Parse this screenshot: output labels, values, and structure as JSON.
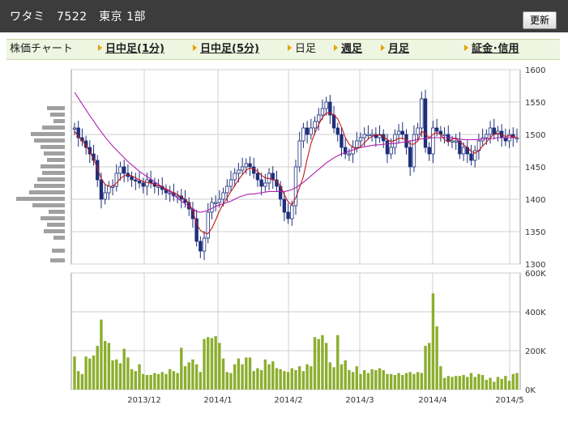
{
  "header": {
    "title": "ワタミ　7522　東京 1部",
    "refresh_label": "更新"
  },
  "tabs": [
    {
      "label": "株価チャート",
      "link": false,
      "arrow": false
    },
    {
      "label": "日中足(1分)",
      "link": true,
      "arrow": true
    },
    {
      "label": "日中足(5分)",
      "link": true,
      "arrow": true
    },
    {
      "label": "日足",
      "link": false,
      "arrow": true
    },
    {
      "label": "週足",
      "link": true,
      "arrow": true
    },
    {
      "label": "月足",
      "link": true,
      "arrow": true
    },
    {
      "label": "証金･信用",
      "link": true,
      "arrow": true
    }
  ],
  "colors": {
    "up": "#1f2f7a",
    "down": "#1f2f7a",
    "ma_short": "#c01a1a",
    "ma_long": "#b020b0",
    "volume": "#8cae2e",
    "profile": "#a0a0a0",
    "grid": "#cfcfcf"
  },
  "chart_data": [
    {
      "type": "candlestick",
      "title": "",
      "ylim": [
        1300,
        1600
      ],
      "yticks": [
        "1600",
        "1550",
        "1500",
        "1450",
        "1400",
        "1350",
        "1300"
      ],
      "x_labels": [
        "2013/12",
        "2014/1",
        "2014/2",
        "2014/3",
        "2014/4",
        "2014/5"
      ],
      "close": [
        1510,
        1495,
        1490,
        1480,
        1470,
        1460,
        1430,
        1400,
        1410,
        1420,
        1420,
        1440,
        1450,
        1440,
        1435,
        1430,
        1428,
        1425,
        1420,
        1430,
        1425,
        1420,
        1420,
        1415,
        1410,
        1410,
        1405,
        1405,
        1400,
        1395,
        1385,
        1370,
        1335,
        1320,
        1340,
        1380,
        1395,
        1395,
        1400,
        1410,
        1420,
        1430,
        1440,
        1445,
        1450,
        1455,
        1450,
        1440,
        1430,
        1420,
        1425,
        1440,
        1430,
        1420,
        1400,
        1380,
        1370,
        1390,
        1450,
        1490,
        1510,
        1500,
        1510,
        1520,
        1530,
        1540,
        1550,
        1530,
        1510,
        1500,
        1480,
        1470,
        1470,
        1480,
        1490,
        1495,
        1500,
        1500,
        1500,
        1495,
        1500,
        1490,
        1470,
        1480,
        1500,
        1505,
        1500,
        1480,
        1450,
        1500,
        1510,
        1555,
        1480,
        1470,
        1510,
        1505,
        1500,
        1500,
        1490,
        1490,
        1490,
        1470,
        1480,
        1470,
        1460,
        1475,
        1490,
        1495,
        1500,
        1510,
        1500,
        1505,
        1495,
        1490,
        1500,
        1495,
        1495
      ],
      "ma_short": [
        1505,
        1497,
        1490,
        1483,
        1473,
        1462,
        1448,
        1432,
        1423,
        1420,
        1420,
        1425,
        1432,
        1436,
        1438,
        1436,
        1433,
        1430,
        1427,
        1426,
        1425,
        1423,
        1421,
        1419,
        1416,
        1413,
        1410,
        1407,
        1404,
        1400,
        1394,
        1382,
        1362,
        1352,
        1348,
        1347,
        1355,
        1368,
        1382,
        1393,
        1402,
        1412,
        1421,
        1430,
        1438,
        1445,
        1448,
        1447,
        1443,
        1437,
        1433,
        1432,
        1431,
        1428,
        1420,
        1407,
        1396,
        1391,
        1402,
        1418,
        1435,
        1462,
        1486,
        1502,
        1515,
        1526,
        1533,
        1533,
        1530,
        1524,
        1511,
        1495,
        1485,
        1480,
        1478,
        1481,
        1487,
        1493,
        1497,
        1499,
        1499,
        1497,
        1492,
        1489,
        1491,
        1494,
        1494,
        1492,
        1485,
        1485,
        1490,
        1505,
        1501,
        1495,
        1500,
        1503,
        1500,
        1492,
        1488,
        1493,
        1494,
        1489,
        1484,
        1480,
        1474,
        1471,
        1475,
        1482,
        1488,
        1495,
        1501,
        1502,
        1499,
        1497,
        1498,
        1497,
        1495
      ],
      "ma_long": [
        1565,
        1556,
        1547,
        1538,
        1529,
        1521,
        1512,
        1504,
        1496,
        1489,
        1482,
        1476,
        1470,
        1464,
        1458,
        1453,
        1448,
        1443,
        1439,
        1435,
        1431,
        1427,
        1423,
        1419,
        1415,
        1411,
        1407,
        1402,
        1397,
        1393,
        1389,
        1385,
        1381,
        1380,
        1381,
        1383,
        1386,
        1389,
        1391,
        1393,
        1395,
        1397,
        1400,
        1403,
        1405,
        1407,
        1408,
        1408,
        1409,
        1410,
        1411,
        1412,
        1412,
        1412,
        1412,
        1412,
        1413,
        1415,
        1418,
        1422,
        1426,
        1431,
        1436,
        1441,
        1446,
        1451,
        1456,
        1460,
        1464,
        1467,
        1470,
        1472,
        1474,
        1476,
        1478,
        1480,
        1481,
        1482,
        1483,
        1484,
        1484,
        1485,
        1485,
        1486,
        1486,
        1487,
        1488,
        1489,
        1490,
        1491,
        1492,
        1493,
        1494,
        1494,
        1495,
        1495,
        1495,
        1495,
        1495,
        1495,
        1494,
        1493,
        1492,
        1492,
        1492,
        1492,
        1492,
        1493,
        1493,
        1494,
        1494,
        1495,
        1495,
        1495,
        1495,
        1495,
        1495
      ]
    },
    {
      "type": "bar",
      "title": "",
      "ylim": [
        0,
        600000
      ],
      "yticks": [
        "600K",
        "400K",
        "200K",
        "0K"
      ],
      "values": [
        170000,
        95000,
        80000,
        170000,
        160000,
        175000,
        225000,
        360000,
        250000,
        240000,
        150000,
        155000,
        135000,
        210000,
        165000,
        105000,
        95000,
        130000,
        80000,
        75000,
        75000,
        85000,
        80000,
        90000,
        80000,
        105000,
        95000,
        85000,
        215000,
        120000,
        140000,
        155000,
        130000,
        90000,
        260000,
        270000,
        265000,
        275000,
        240000,
        160000,
        90000,
        85000,
        130000,
        160000,
        130000,
        165000,
        165000,
        95000,
        110000,
        100000,
        155000,
        130000,
        145000,
        110000,
        105000,
        95000,
        90000,
        110000,
        100000,
        120000,
        95000,
        130000,
        120000,
        270000,
        260000,
        280000,
        240000,
        140000,
        115000,
        280000,
        130000,
        150000,
        100000,
        90000,
        120000,
        80000,
        100000,
        85000,
        105000,
        100000,
        110000,
        100000,
        80000,
        80000,
        75000,
        85000,
        75000,
        85000,
        90000,
        80000,
        90000,
        85000,
        225000,
        240000,
        495000,
        325000,
        120000,
        60000,
        70000,
        65000,
        70000,
        70000,
        75000,
        65000,
        85000,
        65000,
        80000,
        75000,
        50000,
        60000,
        40000,
        65000,
        55000,
        70000,
        45000,
        80000,
        85000
      ]
    }
  ]
}
